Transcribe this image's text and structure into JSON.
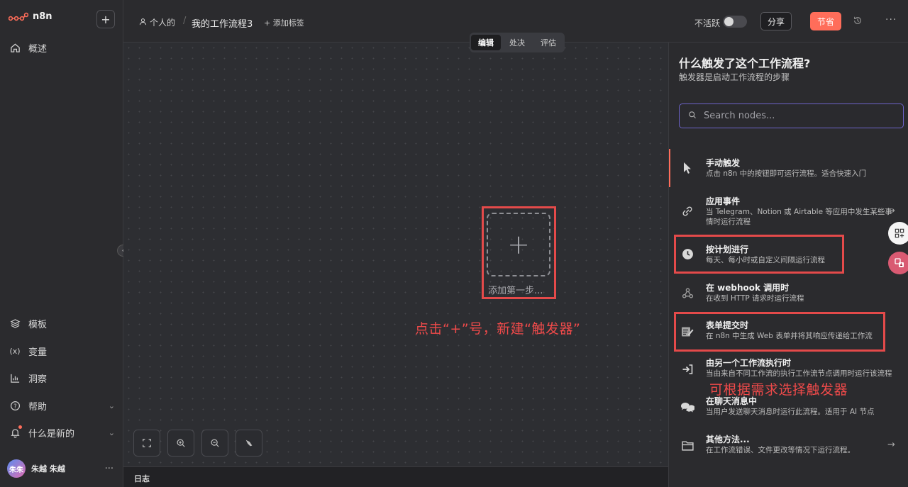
{
  "app": {
    "name": "n8n"
  },
  "sidebar": {
    "overview": "概述",
    "bottom": [
      {
        "label": "模板",
        "icon": "layers-icon"
      },
      {
        "label": "变量",
        "icon": "variable-icon"
      },
      {
        "label": "洞察",
        "icon": "chart-icon"
      },
      {
        "label": "帮助",
        "icon": "help-icon"
      },
      {
        "label": "什么是新的",
        "icon": "bell-icon"
      }
    ],
    "user": {
      "avatar_text": "朱朱",
      "name": "朱越 朱越"
    }
  },
  "header": {
    "owner": "个人的",
    "workflow_name": "我的工作流程3",
    "add_tag": "+ 添加标签",
    "inactive_label": "不活跃",
    "share": "分享",
    "save": "节省",
    "more": "···"
  },
  "tabs": [
    "编辑",
    "处决",
    "评估"
  ],
  "canvas": {
    "add_first_step": "添加第一步...",
    "annotation_click": "点击“+”号，新建“触发器”",
    "log": "日志"
  },
  "panel": {
    "title": "什么触发了这个工作流程?",
    "subtitle": "触发器是启动工作流程的步骤",
    "search_placeholder": "Search nodes...",
    "annotation_choose": "可根据需求选择触发器",
    "items": [
      {
        "title": "手动触发",
        "desc": "点击 n8n 中的按钮即可运行流程。适合快速入门",
        "icon": "cursor-icon"
      },
      {
        "title": "应用事件",
        "desc": "当 Telegram、Notion 或 Airtable 等应用中发生某些事情时运行流程",
        "icon": "app-event-icon"
      },
      {
        "title": "按计划进行",
        "desc": "每天、每小时或自定义间隔运行流程",
        "icon": "clock-icon"
      },
      {
        "title": "在 webhook 调用时",
        "desc": "在收到 HTTP 请求时运行流程",
        "icon": "webhook-icon"
      },
      {
        "title": "表单提交时",
        "desc": "在 n8n 中生成 Web 表单并将其响应传递给工作流",
        "icon": "form-icon"
      },
      {
        "title": "由另一个工作流执行时",
        "desc": "当由来自不同工作流的执行工作流节点调用时运行该流程",
        "icon": "sign-in-icon"
      },
      {
        "title": "在聊天消息中",
        "desc": "当用户发送聊天消息时运行此流程。适用于 AI 节点",
        "icon": "chat-icon"
      },
      {
        "title": "其他方法...",
        "desc": "在工作流错误、文件更改等情况下运行流程。",
        "icon": "folder-icon"
      }
    ]
  },
  "colors": {
    "accent": "#ff6d5a",
    "annotation": "#e44a4a"
  }
}
